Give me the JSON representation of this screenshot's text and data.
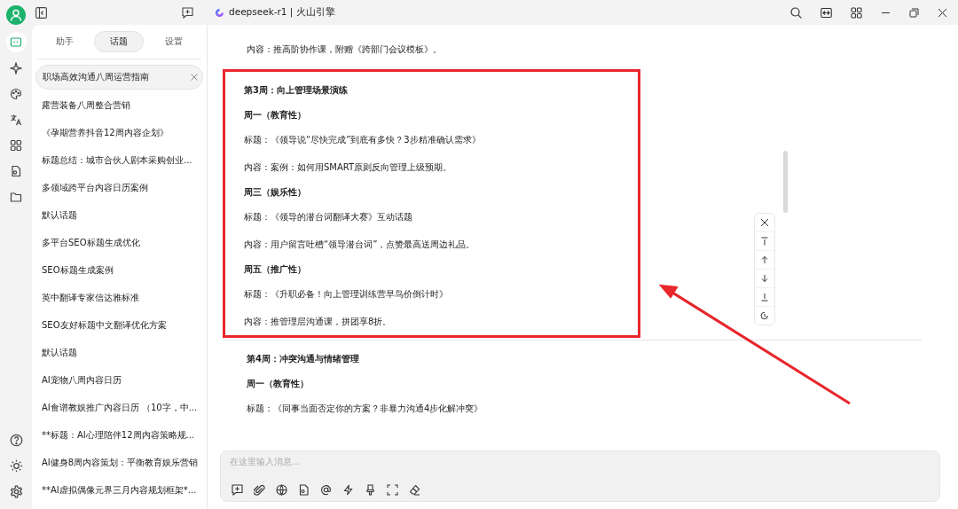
{
  "window": {
    "title": "deepseek-r1 | 火山引擎"
  },
  "nav_rail": {
    "items": [
      {
        "selected": true
      },
      {
        "selected": false
      },
      {
        "selected": false
      },
      {
        "selected": false
      },
      {
        "selected": false
      },
      {
        "selected": false
      },
      {
        "selected": false
      }
    ]
  },
  "sidebar": {
    "tabs": [
      {
        "label": "助手",
        "selected": false
      },
      {
        "label": "话题",
        "selected": true
      },
      {
        "label": "设置",
        "selected": false
      }
    ],
    "topics": [
      {
        "label": "职场高效沟通八周运营指南",
        "selected": true
      },
      {
        "label": "露营装备八周整合营销",
        "selected": false
      },
      {
        "label": "《孕期营养抖音12周内容企划》",
        "selected": false
      },
      {
        "label": "标题总结：城市合伙人剧本采购创业...",
        "selected": false
      },
      {
        "label": "多领域跨平台内容日历案例",
        "selected": false
      },
      {
        "label": "默认话题",
        "selected": false
      },
      {
        "label": "多平台SEO标题生成优化",
        "selected": false
      },
      {
        "label": "SEO标题生成案例",
        "selected": false
      },
      {
        "label": "英中翻译专家信达雅标准",
        "selected": false
      },
      {
        "label": "SEO友好标题中文翻译优化方案",
        "selected": false
      },
      {
        "label": "默认话题",
        "selected": false
      },
      {
        "label": "AI宠物八周内容日历",
        "selected": false
      },
      {
        "label": "AI食谱教娱推广内容日历 （10字，中...",
        "selected": false
      },
      {
        "label": "**标题：AI心理陪伴12周内容策略规...",
        "selected": false
      },
      {
        "label": "AI健身8周内容策划：平衡教育娱乐营销",
        "selected": false
      },
      {
        "label": "**AI虚拟偶像元界三月内容规划框架*...",
        "selected": false
      }
    ]
  },
  "content": {
    "sections": [
      {
        "highlighted": false,
        "lines": [
          {
            "kind": "text",
            "text": "内容：推高阶协作课，附赠《跨部门会议模板》。"
          }
        ]
      },
      {
        "highlighted": true,
        "lines": [
          {
            "kind": "week",
            "text": "第3周：向上管理场景演练"
          },
          {
            "kind": "day",
            "text": "周一（教育性）"
          },
          {
            "kind": "text",
            "text": "标题：《领导说“尽快完成”到底有多快？3步精准确认需求》"
          },
          {
            "kind": "text",
            "text": "内容：案例：如何用SMART原则反向管理上级预期。"
          },
          {
            "kind": "day",
            "text": "周三（娱乐性）"
          },
          {
            "kind": "text",
            "text": "标题：《领导的潜台词翻译大赛》互动话题"
          },
          {
            "kind": "text",
            "text": "内容：用户留言吐槽“领导潜台词”，点赞最高送周边礼品。"
          },
          {
            "kind": "day",
            "text": "周五（推广性）"
          },
          {
            "kind": "text",
            "text": "标题：《升职必备！向上管理训练营早鸟价倒计时》"
          },
          {
            "kind": "text",
            "text": "内容：推管理层沟通课，拼团享8折。"
          }
        ]
      },
      {
        "highlighted": false,
        "lines": [
          {
            "kind": "week",
            "text": "第4周：冲突沟通与情绪管理"
          },
          {
            "kind": "day",
            "text": "周一（教育性）"
          },
          {
            "kind": "text",
            "text": "标题：《同事当面否定你的方案？非暴力沟通4步化解冲突》"
          }
        ]
      }
    ]
  },
  "composer": {
    "placeholder": "在这里输入消息..."
  }
}
